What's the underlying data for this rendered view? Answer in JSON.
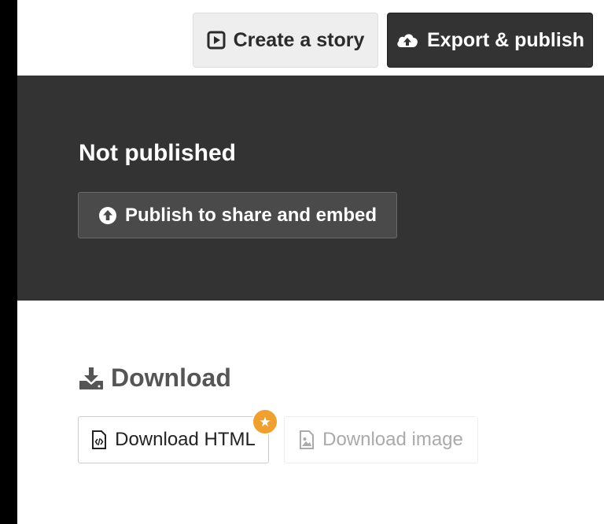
{
  "topbar": {
    "create_story_label": "Create a story",
    "export_publish_label": "Export & publish"
  },
  "publish": {
    "status_title": "Not published",
    "publish_button_label": "Publish to share and embed"
  },
  "download": {
    "heading": "Download",
    "html_button_label": "Download HTML",
    "image_button_label": "Download image",
    "html_button_badge": "star-icon"
  },
  "colors": {
    "panel_dark": "#333333",
    "badge_orange": "#f0a030",
    "disabled_text": "#aaaaaa"
  }
}
